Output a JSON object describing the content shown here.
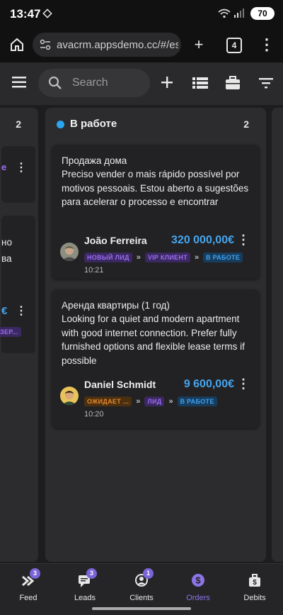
{
  "status_bar": {
    "time": "13:47",
    "battery": "70"
  },
  "browser": {
    "url": "avacrm.appsdemo.cc/#/est",
    "tab_count": "4"
  },
  "app_bar": {
    "search_placeholder": "Search"
  },
  "left_column": {
    "count": "2",
    "partial_text_1": "но",
    "partial_text_2": "ва",
    "price_fragment": "€",
    "tag_fragment": "ЗЕР..."
  },
  "column": {
    "title": "В работе",
    "count": "2",
    "cards": [
      {
        "title": "Продажа дома",
        "description": "Preciso vender o mais rápido possível por motivos pessoais. Estou aberto a sugestões para acelerar o processo e encontrar",
        "client": "João Ferreira",
        "price": "320 000,00€",
        "tags": [
          "НОВЫЙ ЛИД",
          "VIP КЛИЕНТ",
          "В РАБОТЕ"
        ],
        "time": "10:21"
      },
      {
        "title": "Аренда квартиры (1 год)",
        "description": "Looking for a quiet and modern apartment with good internet connection. Prefer fully furnished options and flexible lease terms if possible",
        "client": "Daniel Schmidt",
        "price": "9 600,00€",
        "tags": [
          "ОЖИДАЕТ ...",
          "ЛИД",
          "В РАБОТЕ"
        ],
        "time": "10:20"
      }
    ]
  },
  "colors": {
    "accent": "#46a6ee",
    "purple": "#9d6cf0",
    "orange": "#e8882a",
    "nav_active": "#8b74e6"
  },
  "nav": [
    {
      "label": "Feed",
      "badge": "3",
      "icon": "feed-icon"
    },
    {
      "label": "Leads",
      "badge": "3",
      "icon": "leads-icon"
    },
    {
      "label": "Clients",
      "badge": "1",
      "icon": "clients-icon"
    },
    {
      "label": "Orders",
      "badge": "",
      "icon": "orders-icon",
      "active": true
    },
    {
      "label": "Debits",
      "badge": "",
      "icon": "debits-icon"
    }
  ]
}
